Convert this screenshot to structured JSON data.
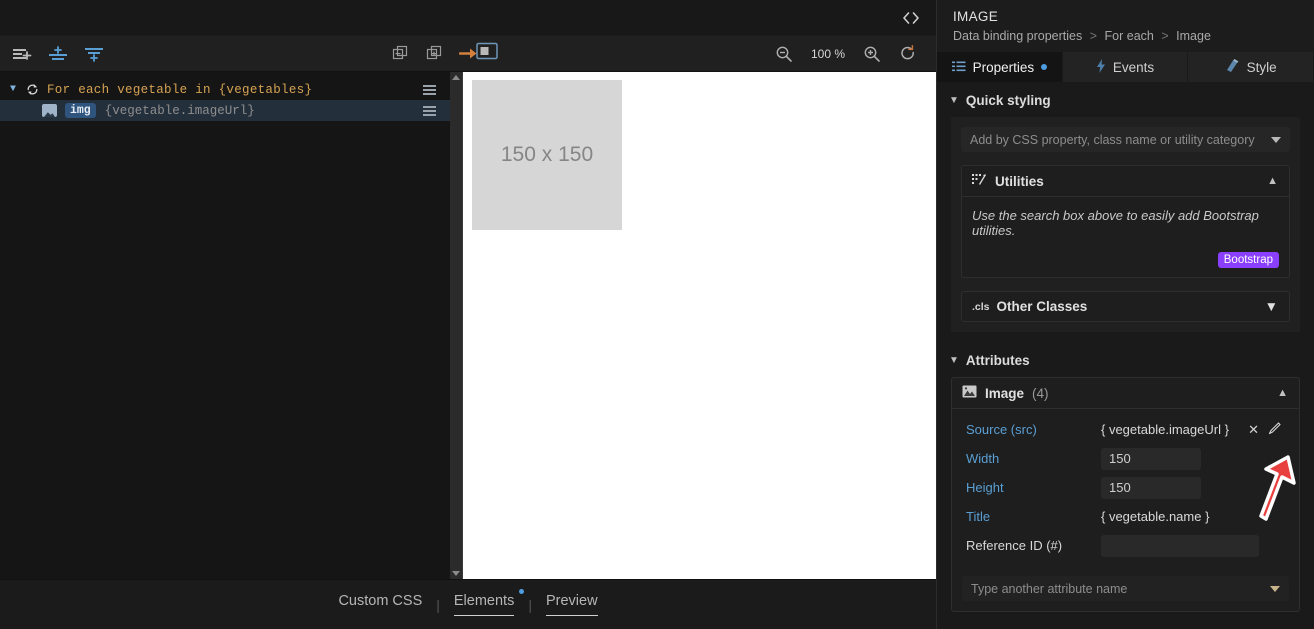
{
  "editor": {
    "toolbar": {
      "icons": [
        "add-element-icon",
        "insert-before-icon",
        "insert-after-icon",
        "copy-icon",
        "duplicate-icon",
        "move-icon",
        "panel-toggle-icon"
      ],
      "zoom_level": "100 %",
      "zoom_out_icon": "zoom-out-icon",
      "zoom_in_icon": "zoom-in-icon",
      "reset_icon": "reload-icon",
      "code_icon": "code-brackets-icon"
    },
    "tree": {
      "rows": [
        {
          "kind": "loop",
          "icon": "loop-icon",
          "caret": "chevron-down-icon",
          "text": "For each vegetable in {vegetables}",
          "menu": "row-menu-icon",
          "selected": false
        },
        {
          "kind": "element",
          "icon": "image-thumbnail-icon",
          "tag": "img",
          "binding": "{vegetable.imageUrl}",
          "menu": "row-menu-icon",
          "selected": true
        }
      ]
    },
    "canvas": {
      "placeholder_text": "150 x 150"
    },
    "bottom_tabs": [
      {
        "label": "Custom CSS",
        "active": false,
        "underlined": false,
        "dot": false
      },
      {
        "label": "Elements",
        "active": true,
        "underlined": true,
        "dot": true
      },
      {
        "label": "Preview",
        "active": false,
        "underlined": true,
        "dot": false
      }
    ],
    "tab_separator": "|"
  },
  "inspector": {
    "title": "IMAGE",
    "breadcrumb": {
      "items": [
        "Data binding properties",
        "For each",
        "Image"
      ],
      "separator": ">"
    },
    "tabs": [
      {
        "label": "Properties",
        "icon": "list-icon",
        "active": true,
        "dot": true
      },
      {
        "label": "Events",
        "icon": "bolt-icon",
        "active": false,
        "dot": false
      },
      {
        "label": "Style",
        "icon": "brush-icon",
        "active": false,
        "dot": false
      }
    ],
    "quick_styling": {
      "heading": "Quick styling",
      "chevron": "chevron-down-icon",
      "search_placeholder": "Add by CSS property, class name or utility category",
      "utilities": {
        "icon": "utilities-icon",
        "title": "Utilities",
        "chevron": "chevron-up-icon",
        "hint": "Use the search box above to easily add Bootstrap utilities.",
        "badge": "Bootstrap"
      },
      "other_classes": {
        "icon": ".cls",
        "title": "Other Classes",
        "chevron": "chevron-down-icon"
      }
    },
    "attributes": {
      "heading": "Attributes",
      "chevron": "chevron-down-icon",
      "group": {
        "icon": "image-icon",
        "title": "Image",
        "count": "(4)",
        "chevron": "chevron-up-icon"
      },
      "rows": [
        {
          "label": "Source (src)",
          "value": "{ vegetable.imageUrl }",
          "type": "text",
          "label_style": "link",
          "actions": [
            "clear-icon",
            "edit-icon"
          ]
        },
        {
          "label": "Width",
          "value": "150",
          "type": "input",
          "label_style": "link",
          "actions": []
        },
        {
          "label": "Height",
          "value": "150",
          "type": "input",
          "label_style": "link",
          "actions": []
        },
        {
          "label": "Title",
          "value": "{ vegetable.name }",
          "type": "text",
          "label_style": "link",
          "actions": []
        },
        {
          "label": "Reference ID (#)",
          "value": "",
          "type": "input-wide",
          "label_style": "plain",
          "actions": []
        }
      ],
      "add_placeholder": "Type another attribute name"
    }
  },
  "annotation": {
    "arrow": "red-arrow-up-right",
    "color": "#e8403f"
  }
}
